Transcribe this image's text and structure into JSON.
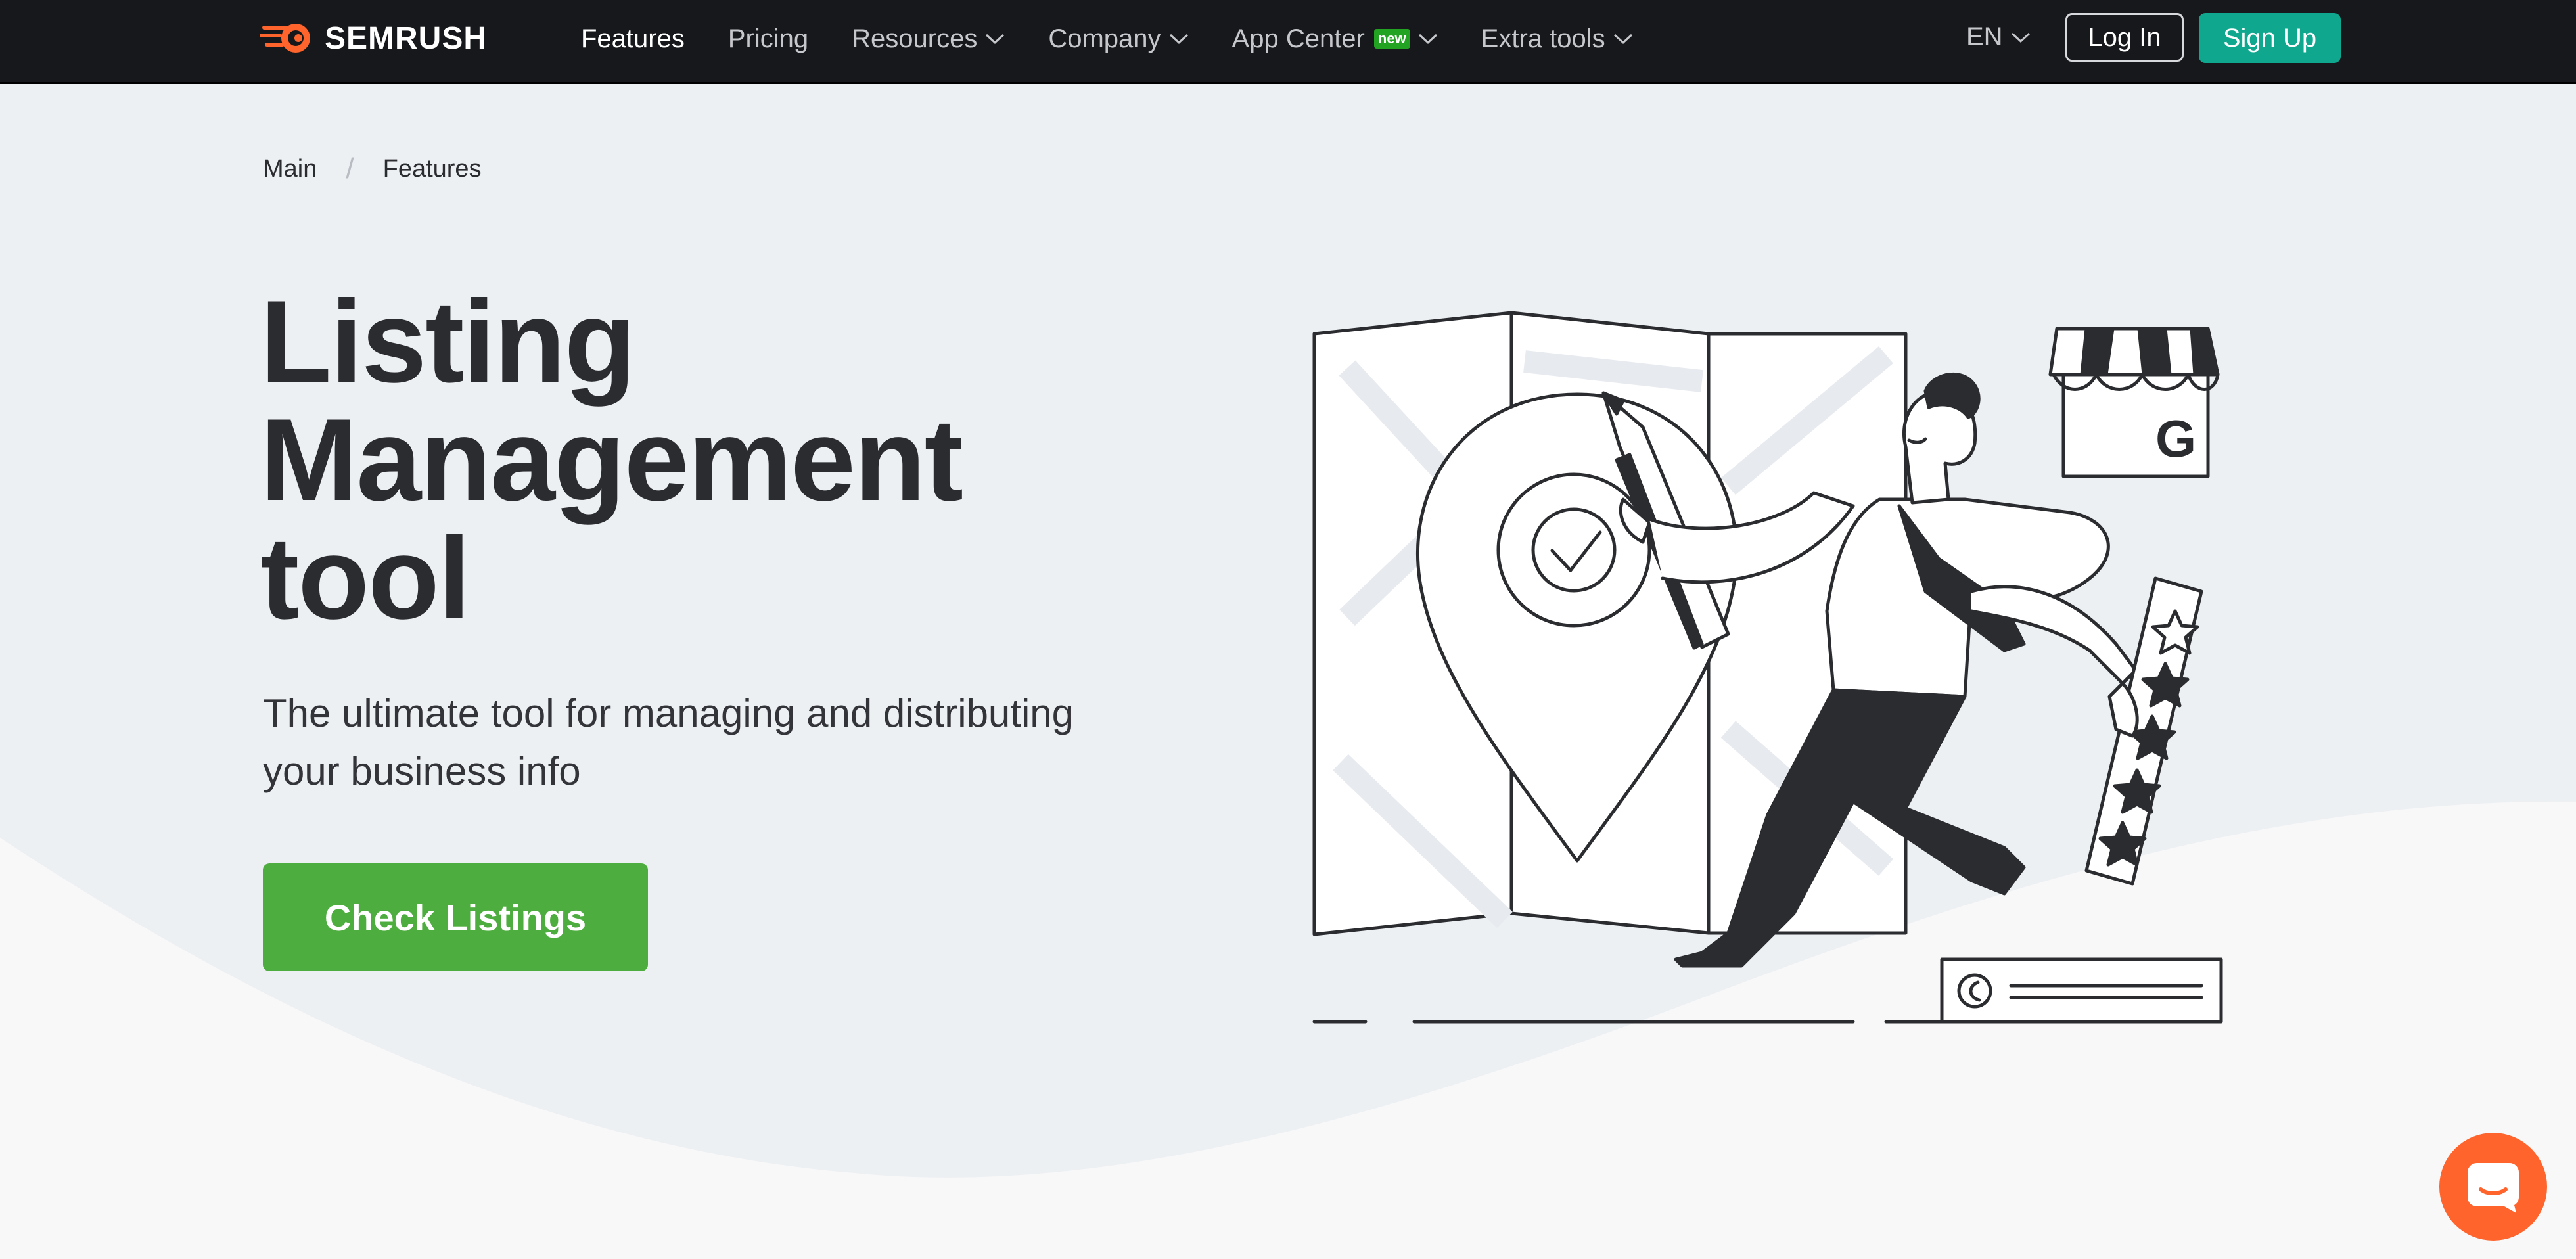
{
  "brand": {
    "name": "SEMRUSH",
    "accent": "#ff642d"
  },
  "nav": {
    "items": [
      {
        "label": "Features",
        "active": true,
        "dropdown": false
      },
      {
        "label": "Pricing",
        "active": false,
        "dropdown": false
      },
      {
        "label": "Resources",
        "active": false,
        "dropdown": true
      },
      {
        "label": "Company",
        "active": false,
        "dropdown": true
      },
      {
        "label": "App Center",
        "active": false,
        "dropdown": true,
        "badge": "new"
      },
      {
        "label": "Extra tools",
        "active": false,
        "dropdown": true
      }
    ],
    "language": "EN",
    "login_label": "Log In",
    "signup_label": "Sign Up"
  },
  "breadcrumb": {
    "main": "Main",
    "current": "Features"
  },
  "hero": {
    "title_line1": "Listing",
    "title_line2": "Management",
    "title_line3": "tool",
    "subtitle_line1": "The ultimate tool for managing and distributing",
    "subtitle_line2": "your business info",
    "cta_label": "Check Listings"
  },
  "colors": {
    "header_bg": "#17181b",
    "signup_bg": "#0fa88f",
    "cta_bg": "#4ead3f",
    "hero_bg": "#edf0f3",
    "chat_bg": "#ff642d"
  },
  "icons": [
    "semrush-logo-icon",
    "chevron-down-icon",
    "map-pin-icon",
    "star-icon",
    "google-store-icon",
    "chat-icon"
  ]
}
